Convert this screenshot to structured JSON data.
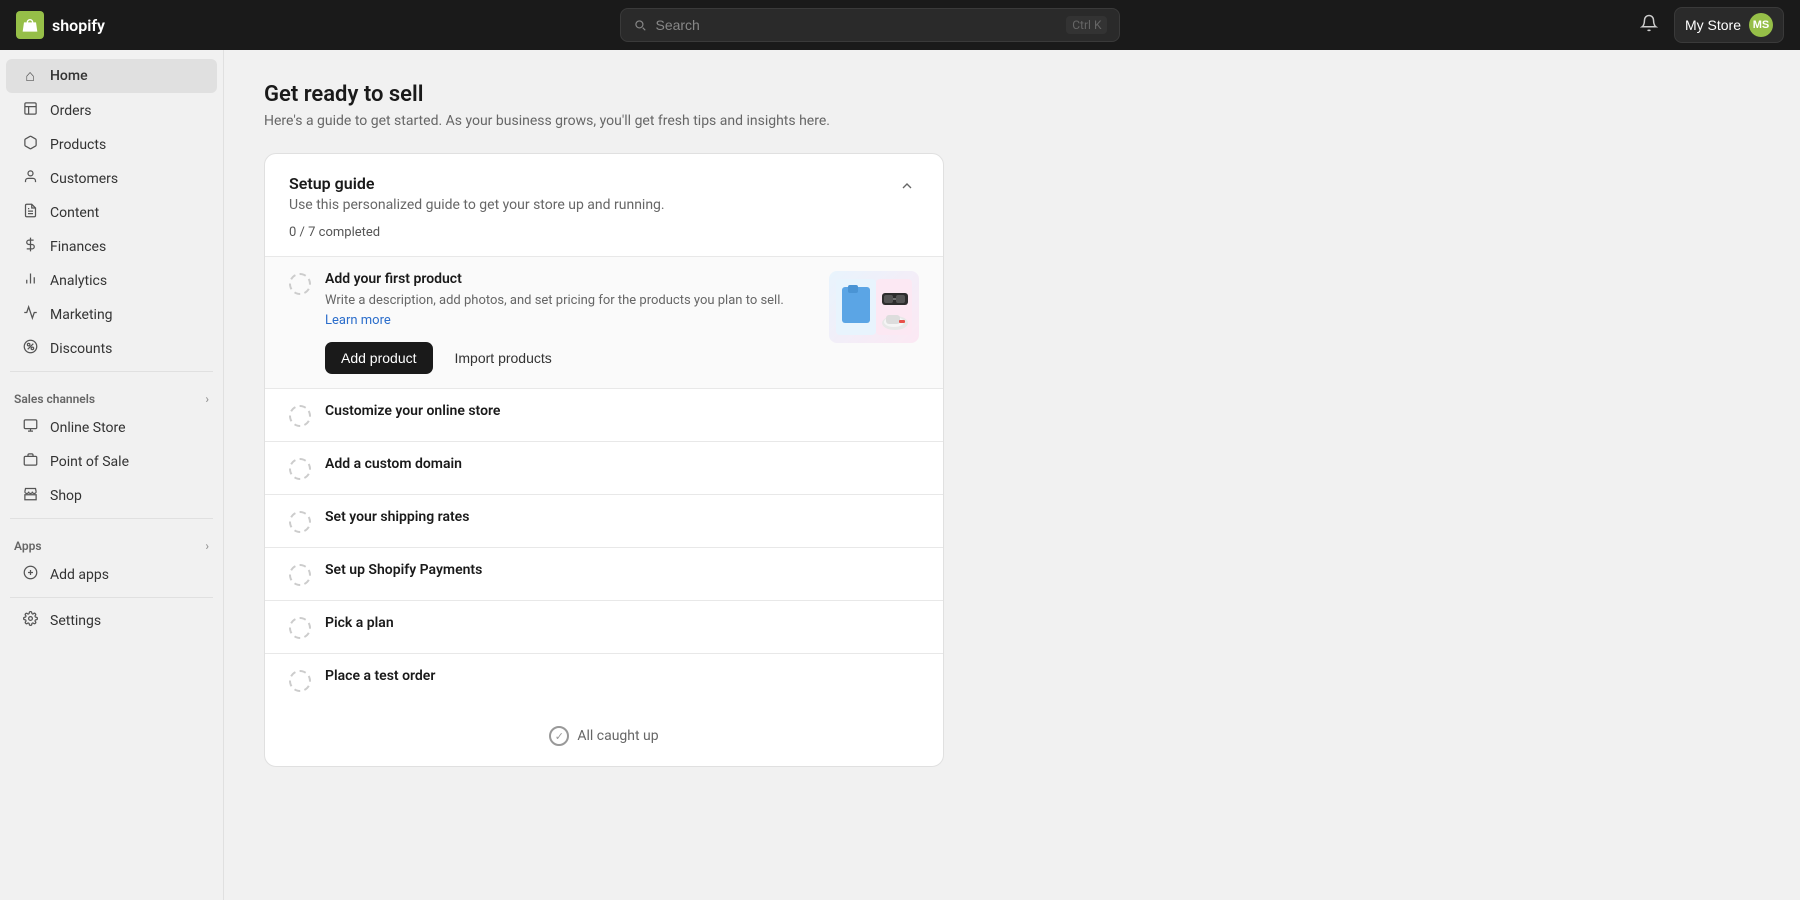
{
  "topbar": {
    "logo_text": "shopify",
    "search_placeholder": "Search",
    "search_shortcut": "Ctrl K",
    "bell_icon": "🔔",
    "store_name": "My Store",
    "avatar_initials": "MS"
  },
  "sidebar": {
    "nav_items": [
      {
        "id": "home",
        "label": "Home",
        "icon": "⌂",
        "active": true
      },
      {
        "id": "orders",
        "label": "Orders",
        "icon": "📋",
        "active": false
      },
      {
        "id": "products",
        "label": "Products",
        "icon": "📦",
        "active": false
      },
      {
        "id": "customers",
        "label": "Customers",
        "icon": "👤",
        "active": false
      },
      {
        "id": "content",
        "label": "Content",
        "icon": "📄",
        "active": false
      },
      {
        "id": "finances",
        "label": "Finances",
        "icon": "💰",
        "active": false
      },
      {
        "id": "analytics",
        "label": "Analytics",
        "icon": "📊",
        "active": false
      },
      {
        "id": "marketing",
        "label": "Marketing",
        "icon": "📣",
        "active": false
      },
      {
        "id": "discounts",
        "label": "Discounts",
        "icon": "🏷",
        "active": false
      }
    ],
    "sales_channels_label": "Sales channels",
    "sales_channels": [
      {
        "id": "online-store",
        "label": "Online Store",
        "icon": "🖥"
      },
      {
        "id": "point-of-sale",
        "label": "Point of Sale",
        "icon": "🛍"
      },
      {
        "id": "shop",
        "label": "Shop",
        "icon": "🛒"
      }
    ],
    "apps_label": "Apps",
    "add_apps_label": "Add apps",
    "settings_label": "Settings"
  },
  "main": {
    "title": "Get ready to sell",
    "subtitle": "Here's a guide to get started. As your business grows, you'll get fresh tips and insights here.",
    "setup_guide": {
      "heading": "Setup guide",
      "description": "Use this personalized guide to get your store up and running.",
      "progress": "0 / 7",
      "progress_suffix": "completed",
      "collapse_icon": "∧",
      "items": [
        {
          "id": "add-product",
          "title": "Add your first product",
          "description": "Write a description, add photos, and set pricing for the products you plan to sell.",
          "link_text": "Learn more",
          "btn_primary": "Add product",
          "btn_secondary": "Import products",
          "active": true,
          "has_image": true
        },
        {
          "id": "customize-store",
          "title": "Customize your online store",
          "active": false,
          "has_image": false
        },
        {
          "id": "custom-domain",
          "title": "Add a custom domain",
          "active": false,
          "has_image": false
        },
        {
          "id": "shipping",
          "title": "Set your shipping rates",
          "active": false,
          "has_image": false
        },
        {
          "id": "payments",
          "title": "Set up Shopify Payments",
          "active": false,
          "has_image": false
        },
        {
          "id": "plan",
          "title": "Pick a plan",
          "active": false,
          "has_image": false
        },
        {
          "id": "test-order",
          "title": "Place a test order",
          "active": false,
          "has_image": false
        }
      ]
    },
    "caught_up": "All caught up"
  }
}
